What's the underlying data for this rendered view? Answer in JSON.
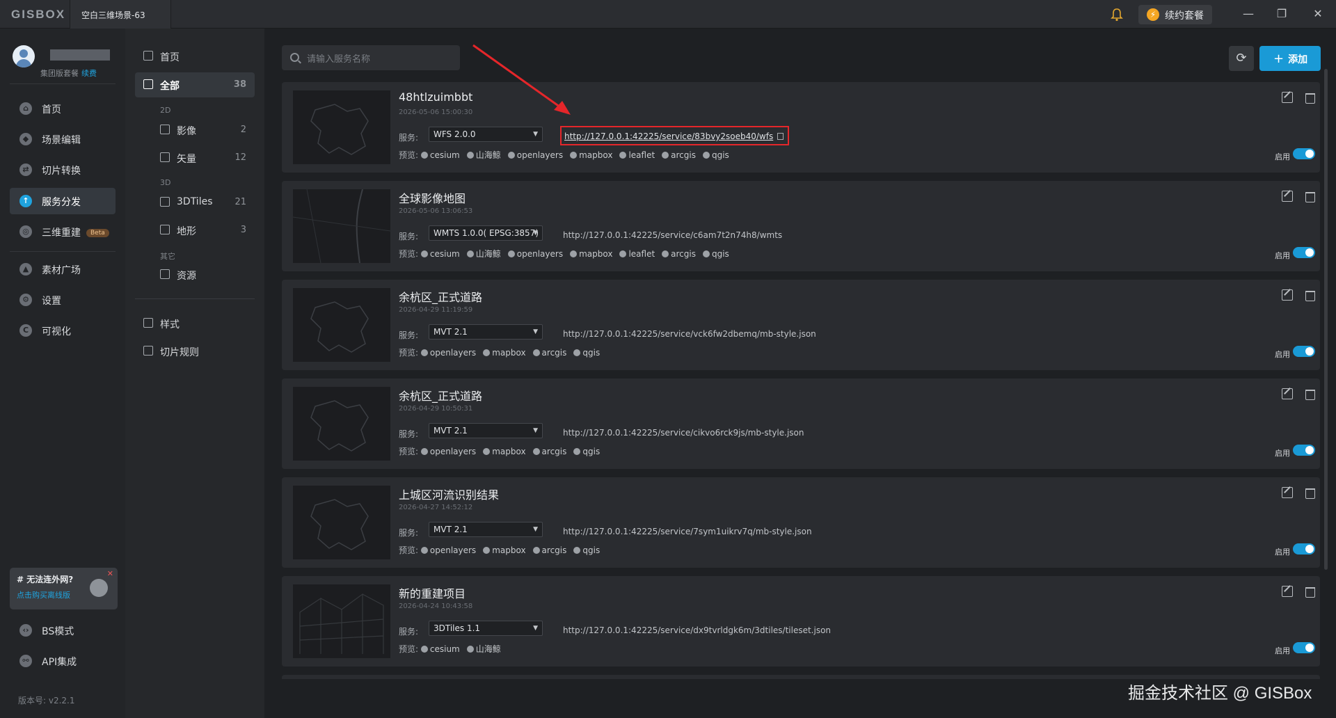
{
  "app": {
    "logo": "GISBOX",
    "window_tab": "空白三维场景-63",
    "renew_label": "续约套餐"
  },
  "user": {
    "plan": "集团版套餐",
    "renew_link": "续费"
  },
  "leftnav": {
    "items": [
      {
        "label": "首页",
        "icon": "home-icon"
      },
      {
        "label": "场景编辑",
        "icon": "cube-icon"
      },
      {
        "label": "切片转换",
        "icon": "convert-icon"
      },
      {
        "label": "服务分发",
        "icon": "upload-cloud-icon",
        "active": true
      },
      {
        "label": "三维重建",
        "icon": "reconstruct-icon",
        "badge": "Beta"
      },
      {
        "label": "素材广场",
        "icon": "image-icon"
      },
      {
        "label": "设置",
        "icon": "gear-icon"
      },
      {
        "label": "可视化",
        "icon": "chart-icon"
      },
      {
        "label": "BS模式",
        "icon": "code-icon"
      },
      {
        "label": "API集成",
        "icon": "api-icon"
      }
    ],
    "promo": {
      "title": "# 无法连外网?",
      "subtitle": "点击购买离线版"
    },
    "version": "版本号: v2.2.1"
  },
  "categories": {
    "home": "首页",
    "all": {
      "label": "全部",
      "count": "38"
    },
    "group_2d": "2D",
    "imagery": {
      "label": "影像",
      "count": "2"
    },
    "vector": {
      "label": "矢量",
      "count": "12"
    },
    "group_3d": "3D",
    "tiles3d": {
      "label": "3DTiles",
      "count": "21"
    },
    "terrain": {
      "label": "地形",
      "count": "3"
    },
    "group_other": "其它",
    "resource": "资源",
    "style": "样式",
    "tile_rule": "切片规则"
  },
  "main": {
    "search_placeholder": "请输入服务名称",
    "add_label": "添加",
    "service_label": "服务:",
    "preview_label": "预览:",
    "enable_label": "启用",
    "cards": [
      {
        "title": "48htlzuimbbt",
        "time": "2026-05-06 15:00:30",
        "service": "WFS 2.0.0",
        "url": "http://127.0.0.1:42225/service/83bvy2soeb40/wfs",
        "highlight": true,
        "previews": [
          "cesium",
          "山海鲸",
          "openlayers",
          "mapbox",
          "leaflet",
          "arcgis",
          "qgis"
        ],
        "enabled": true
      },
      {
        "title": "全球影像地图",
        "time": "2026-05-06 13:06:53",
        "service": "WMTS 1.0.0( EPSG:3857)",
        "url": "http://127.0.0.1:42225/service/c6am7t2n74h8/wmts",
        "highlight": false,
        "previews": [
          "cesium",
          "山海鲸",
          "openlayers",
          "mapbox",
          "leaflet",
          "arcgis",
          "qgis"
        ],
        "enabled": true
      },
      {
        "title": "余杭区_正式道路",
        "time": "2026-04-29 11:19:59",
        "service": "MVT 2.1",
        "url": "http://127.0.0.1:42225/service/vck6fw2dbemq/mb-style.json",
        "highlight": false,
        "previews": [
          "openlayers",
          "mapbox",
          "arcgis",
          "qgis"
        ],
        "enabled": true
      },
      {
        "title": "余杭区_正式道路",
        "time": "2026-04-29 10:50:31",
        "service": "MVT 2.1",
        "url": "http://127.0.0.1:42225/service/cikvo6rck9js/mb-style.json",
        "highlight": false,
        "previews": [
          "openlayers",
          "mapbox",
          "arcgis",
          "qgis"
        ],
        "enabled": true
      },
      {
        "title": "上城区河流识别结果",
        "time": "2026-04-27 14:52:12",
        "service": "MVT 2.1",
        "url": "http://127.0.0.1:42225/service/7sym1uikrv7q/mb-style.json",
        "highlight": false,
        "previews": [
          "openlayers",
          "mapbox",
          "arcgis",
          "qgis"
        ],
        "enabled": true
      },
      {
        "title": "新的重建项目",
        "time": "2026-04-24 10:43:58",
        "service": "3DTiles 1.1",
        "url": "http://127.0.0.1:42225/service/dx9tvrldgk6m/3dtiles/tileset.json",
        "highlight": false,
        "previews": [
          "cesium",
          "山海鲸"
        ],
        "enabled": true
      }
    ]
  },
  "watermark": "掘金技术社区 @ GISBox",
  "colors": {
    "accent": "#1a9ad6",
    "annotation_red": "#e5262a"
  }
}
